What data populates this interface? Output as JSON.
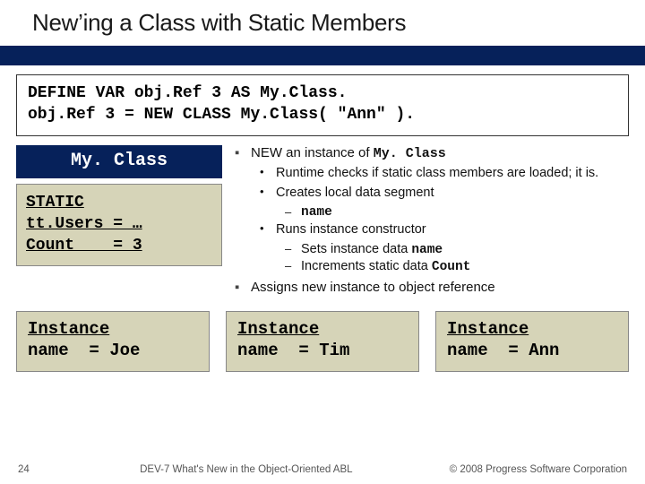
{
  "title": "New’ing a Class with Static Members",
  "code": {
    "line1": "DEFINE VAR obj.Ref 3 AS My.Class.",
    "line2": "obj.Ref 3 = NEW CLASS My.Class( \"Ann\" )."
  },
  "class_label": "My. Class",
  "static_box": {
    "heading": "STATIC",
    "line_users": "tt.Users = …",
    "line_count": "Count    = 3"
  },
  "bullets": {
    "new_line_prefix": "NEW an instance of ",
    "new_line_class": "My. Class",
    "sub1": "Runtime checks if static class members are loaded; it is.",
    "sub2": "Creates local data segment",
    "sub2a_code": "name",
    "sub3": "Runs instance constructor",
    "sub3a_prefix": "Sets instance data ",
    "sub3a_code": "name",
    "sub3b_prefix": "Increments static data ",
    "sub3b_code": "Count",
    "assign": "Assigns new instance to object reference"
  },
  "instances": [
    {
      "heading": "Instance",
      "line": "name  = Joe"
    },
    {
      "heading": "Instance",
      "line": "name  = Tim"
    },
    {
      "heading": "Instance",
      "line": "name  = Ann"
    }
  ],
  "footer": {
    "page": "24",
    "left": "DEV-7 What's New in the Object-Oriented ABL",
    "right": "© 2008 Progress Software Corporation"
  }
}
